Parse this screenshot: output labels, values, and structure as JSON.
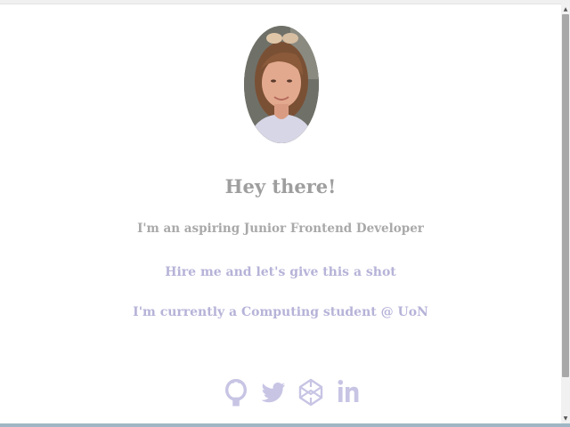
{
  "profile": {
    "avatar_alt": "profile photo"
  },
  "intro": {
    "greeting": "Hey there!",
    "tagline": "I'm an aspiring Junior Frontend Developer",
    "hire_link": "Hire me and let's give this a shot",
    "student_line": "I'm currently a Computing student @ UoN"
  },
  "social": [
    {
      "icon": "github-icon"
    },
    {
      "icon": "twitter-icon"
    },
    {
      "icon": "codepen-icon"
    },
    {
      "icon": "linkedin-icon"
    }
  ],
  "colors": {
    "heading": "#9e9e9e",
    "link": "#b6b3d8",
    "background": "#ffffff"
  }
}
